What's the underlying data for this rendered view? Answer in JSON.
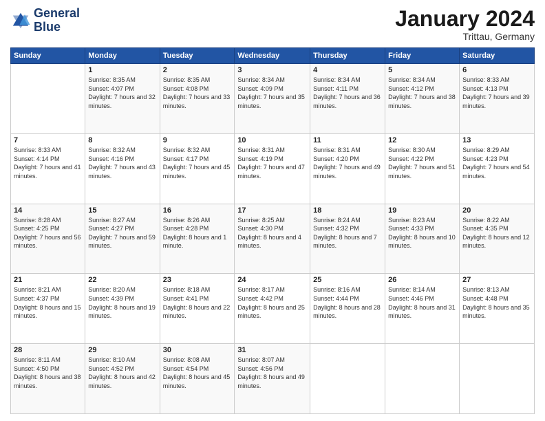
{
  "logo": {
    "line1": "General",
    "line2": "Blue"
  },
  "title": "January 2024",
  "subtitle": "Trittau, Germany",
  "header": {
    "days": [
      "Sunday",
      "Monday",
      "Tuesday",
      "Wednesday",
      "Thursday",
      "Friday",
      "Saturday"
    ]
  },
  "weeks": [
    [
      {
        "day": "",
        "sunrise": "",
        "sunset": "",
        "daylight": ""
      },
      {
        "day": "1",
        "sunrise": "Sunrise: 8:35 AM",
        "sunset": "Sunset: 4:07 PM",
        "daylight": "Daylight: 7 hours and 32 minutes."
      },
      {
        "day": "2",
        "sunrise": "Sunrise: 8:35 AM",
        "sunset": "Sunset: 4:08 PM",
        "daylight": "Daylight: 7 hours and 33 minutes."
      },
      {
        "day": "3",
        "sunrise": "Sunrise: 8:34 AM",
        "sunset": "Sunset: 4:09 PM",
        "daylight": "Daylight: 7 hours and 35 minutes."
      },
      {
        "day": "4",
        "sunrise": "Sunrise: 8:34 AM",
        "sunset": "Sunset: 4:11 PM",
        "daylight": "Daylight: 7 hours and 36 minutes."
      },
      {
        "day": "5",
        "sunrise": "Sunrise: 8:34 AM",
        "sunset": "Sunset: 4:12 PM",
        "daylight": "Daylight: 7 hours and 38 minutes."
      },
      {
        "day": "6",
        "sunrise": "Sunrise: 8:33 AM",
        "sunset": "Sunset: 4:13 PM",
        "daylight": "Daylight: 7 hours and 39 minutes."
      }
    ],
    [
      {
        "day": "7",
        "sunrise": "Sunrise: 8:33 AM",
        "sunset": "Sunset: 4:14 PM",
        "daylight": "Daylight: 7 hours and 41 minutes."
      },
      {
        "day": "8",
        "sunrise": "Sunrise: 8:32 AM",
        "sunset": "Sunset: 4:16 PM",
        "daylight": "Daylight: 7 hours and 43 minutes."
      },
      {
        "day": "9",
        "sunrise": "Sunrise: 8:32 AM",
        "sunset": "Sunset: 4:17 PM",
        "daylight": "Daylight: 7 hours and 45 minutes."
      },
      {
        "day": "10",
        "sunrise": "Sunrise: 8:31 AM",
        "sunset": "Sunset: 4:19 PM",
        "daylight": "Daylight: 7 hours and 47 minutes."
      },
      {
        "day": "11",
        "sunrise": "Sunrise: 8:31 AM",
        "sunset": "Sunset: 4:20 PM",
        "daylight": "Daylight: 7 hours and 49 minutes."
      },
      {
        "day": "12",
        "sunrise": "Sunrise: 8:30 AM",
        "sunset": "Sunset: 4:22 PM",
        "daylight": "Daylight: 7 hours and 51 minutes."
      },
      {
        "day": "13",
        "sunrise": "Sunrise: 8:29 AM",
        "sunset": "Sunset: 4:23 PM",
        "daylight": "Daylight: 7 hours and 54 minutes."
      }
    ],
    [
      {
        "day": "14",
        "sunrise": "Sunrise: 8:28 AM",
        "sunset": "Sunset: 4:25 PM",
        "daylight": "Daylight: 7 hours and 56 minutes."
      },
      {
        "day": "15",
        "sunrise": "Sunrise: 8:27 AM",
        "sunset": "Sunset: 4:27 PM",
        "daylight": "Daylight: 7 hours and 59 minutes."
      },
      {
        "day": "16",
        "sunrise": "Sunrise: 8:26 AM",
        "sunset": "Sunset: 4:28 PM",
        "daylight": "Daylight: 8 hours and 1 minute."
      },
      {
        "day": "17",
        "sunrise": "Sunrise: 8:25 AM",
        "sunset": "Sunset: 4:30 PM",
        "daylight": "Daylight: 8 hours and 4 minutes."
      },
      {
        "day": "18",
        "sunrise": "Sunrise: 8:24 AM",
        "sunset": "Sunset: 4:32 PM",
        "daylight": "Daylight: 8 hours and 7 minutes."
      },
      {
        "day": "19",
        "sunrise": "Sunrise: 8:23 AM",
        "sunset": "Sunset: 4:33 PM",
        "daylight": "Daylight: 8 hours and 10 minutes."
      },
      {
        "day": "20",
        "sunrise": "Sunrise: 8:22 AM",
        "sunset": "Sunset: 4:35 PM",
        "daylight": "Daylight: 8 hours and 12 minutes."
      }
    ],
    [
      {
        "day": "21",
        "sunrise": "Sunrise: 8:21 AM",
        "sunset": "Sunset: 4:37 PM",
        "daylight": "Daylight: 8 hours and 15 minutes."
      },
      {
        "day": "22",
        "sunrise": "Sunrise: 8:20 AM",
        "sunset": "Sunset: 4:39 PM",
        "daylight": "Daylight: 8 hours and 19 minutes."
      },
      {
        "day": "23",
        "sunrise": "Sunrise: 8:18 AM",
        "sunset": "Sunset: 4:41 PM",
        "daylight": "Daylight: 8 hours and 22 minutes."
      },
      {
        "day": "24",
        "sunrise": "Sunrise: 8:17 AM",
        "sunset": "Sunset: 4:42 PM",
        "daylight": "Daylight: 8 hours and 25 minutes."
      },
      {
        "day": "25",
        "sunrise": "Sunrise: 8:16 AM",
        "sunset": "Sunset: 4:44 PM",
        "daylight": "Daylight: 8 hours and 28 minutes."
      },
      {
        "day": "26",
        "sunrise": "Sunrise: 8:14 AM",
        "sunset": "Sunset: 4:46 PM",
        "daylight": "Daylight: 8 hours and 31 minutes."
      },
      {
        "day": "27",
        "sunrise": "Sunrise: 8:13 AM",
        "sunset": "Sunset: 4:48 PM",
        "daylight": "Daylight: 8 hours and 35 minutes."
      }
    ],
    [
      {
        "day": "28",
        "sunrise": "Sunrise: 8:11 AM",
        "sunset": "Sunset: 4:50 PM",
        "daylight": "Daylight: 8 hours and 38 minutes."
      },
      {
        "day": "29",
        "sunrise": "Sunrise: 8:10 AM",
        "sunset": "Sunset: 4:52 PM",
        "daylight": "Daylight: 8 hours and 42 minutes."
      },
      {
        "day": "30",
        "sunrise": "Sunrise: 8:08 AM",
        "sunset": "Sunset: 4:54 PM",
        "daylight": "Daylight: 8 hours and 45 minutes."
      },
      {
        "day": "31",
        "sunrise": "Sunrise: 8:07 AM",
        "sunset": "Sunset: 4:56 PM",
        "daylight": "Daylight: 8 hours and 49 minutes."
      },
      {
        "day": "",
        "sunrise": "",
        "sunset": "",
        "daylight": ""
      },
      {
        "day": "",
        "sunrise": "",
        "sunset": "",
        "daylight": ""
      },
      {
        "day": "",
        "sunrise": "",
        "sunset": "",
        "daylight": ""
      }
    ]
  ]
}
